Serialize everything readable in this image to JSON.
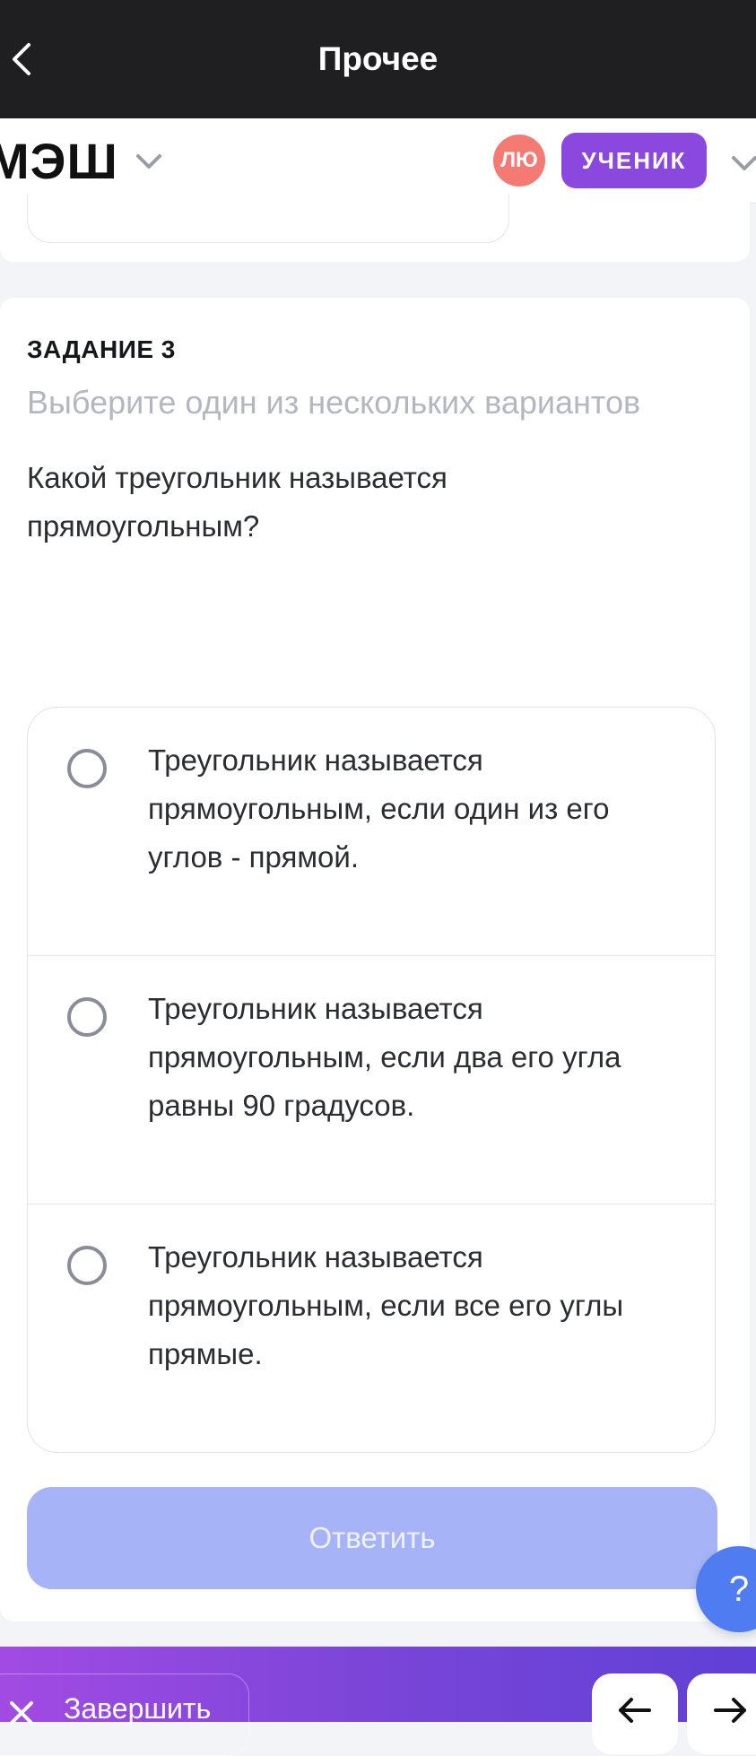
{
  "topbar": {
    "title": "Прочее"
  },
  "header": {
    "logo": "МЭШ",
    "avatar_initials": "ЛЮ",
    "role": "УЧЕНИК"
  },
  "task": {
    "label": "ЗАДАНИЕ 3",
    "hint": "Выберите один из нескольких вариантов",
    "question": "Какой треугольник называется прямоугольным?",
    "options": [
      "Треугольник называется прямоугольным, если один из его углов - прямой.",
      "Треугольник называется прямоугольным, если два его угла равны 90 градусов.",
      "Треугольник называется прямоугольным, если все его углы прямые."
    ],
    "submit_label": "Ответить"
  },
  "help": {
    "label": "?"
  },
  "bottombar": {
    "finish_label": "Завершить"
  },
  "colors": {
    "accent": "#8a48df",
    "submit_disabled": "#a6b4f7",
    "help": "#4f7df1",
    "avatar": "#f47a73"
  }
}
